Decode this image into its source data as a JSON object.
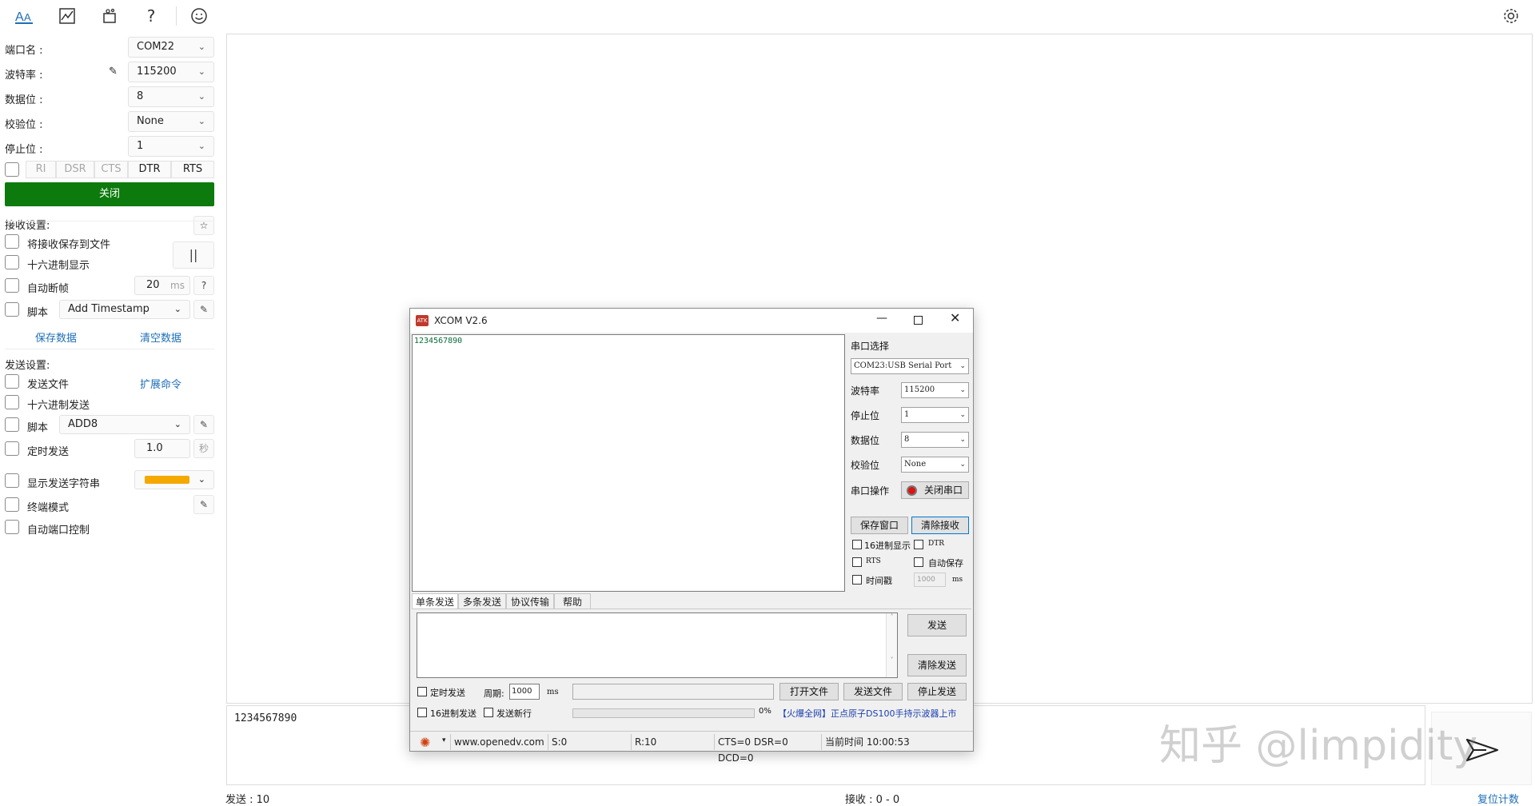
{
  "toolbar": {
    "icons": [
      "font-icon",
      "chart-icon",
      "plugin-icon",
      "help-icon",
      "smiley-icon",
      "gear-icon"
    ]
  },
  "serial": {
    "port_label": "端口名 :",
    "port_value": "COM22",
    "baud_label": "波特率 :",
    "baud_value": "115200",
    "databits_label": "数据位 :",
    "databits_value": "8",
    "parity_label": "校验位 :",
    "parity_value": "None",
    "stopbits_label": "停止位 :",
    "stopbits_value": "1",
    "signals": [
      "RI",
      "DSR",
      "CTS",
      "DTR",
      "RTS"
    ],
    "close_button": "关闭"
  },
  "receive": {
    "title": "接收设置:",
    "save_to_file": "将接收保存到文件",
    "hex_display": "十六进制显示",
    "auto_frame": "自动断帧",
    "auto_frame_value": "20",
    "auto_frame_unit": "ms",
    "script": "脚本",
    "script_value": "Add Timestamp",
    "save_data": "保存数据",
    "clear_data": "清空数据",
    "pause_symbol": "||",
    "star_symbol": "☆",
    "help_symbol": "?"
  },
  "send": {
    "title": "发送设置:",
    "send_file": "发送文件",
    "extend_cmd": "扩展命令",
    "hex_send": "十六进制发送",
    "script": "脚本",
    "script_value": "ADD8",
    "timed_send": "定时发送",
    "timed_value": "1.0",
    "timed_unit": "秒",
    "show_send_string": "显示发送字符串",
    "highlight_color": "#f5a800",
    "terminal_mode": "终端模式",
    "auto_port_control": "自动端口控制"
  },
  "main": {
    "received_text": "1234567890"
  },
  "bottom": {
    "sent_label": "发送 : 10",
    "received_label": "接收 : 0 - 0",
    "reset_counter": "复位计数"
  },
  "watermark": "知乎 @limpidity",
  "xcom": {
    "title": "XCOM V2.6",
    "received_text": "1234567890",
    "port_select_label": "串口选择",
    "port_value": "COM23:USB Serial Port",
    "baud_label": "波特率",
    "baud_value": "115200",
    "stop_label": "停止位",
    "stop_value": "1",
    "data_label": "数据位",
    "data_value": "8",
    "parity_label": "校验位",
    "parity_value": "None",
    "op_label": "串口操作",
    "close_port": "关闭串口",
    "save_window": "保存窗口",
    "clear_recv": "清除接收",
    "hex_display": "16进制显示",
    "dtr": "DTR",
    "rts": "RTS",
    "auto_save": "自动保存",
    "timestamp": "时间戳",
    "timestamp_value": "1000",
    "timestamp_unit": "ms",
    "tabs": [
      "单条发送",
      "多条发送",
      "协议传输",
      "帮助"
    ],
    "send_btn": "发送",
    "clear_send": "清除发送",
    "timed_send": "定时发送",
    "period_label": "周期:",
    "period_value": "1000",
    "period_unit": "ms",
    "open_file": "打开文件",
    "send_file": "发送文件",
    "stop_send": "停止发送",
    "hex_send": "16进制发送",
    "send_newline": "发送新行",
    "progress": "0%",
    "ad_text": "【火爆全网】正点原子DS100手持示波器上市",
    "status_site": "www.openedv.com",
    "status_s": "S:0",
    "status_r": "R:10",
    "status_lines": "CTS=0 DSR=0 DCD=0",
    "status_time": "当前时间 10:00:53"
  }
}
